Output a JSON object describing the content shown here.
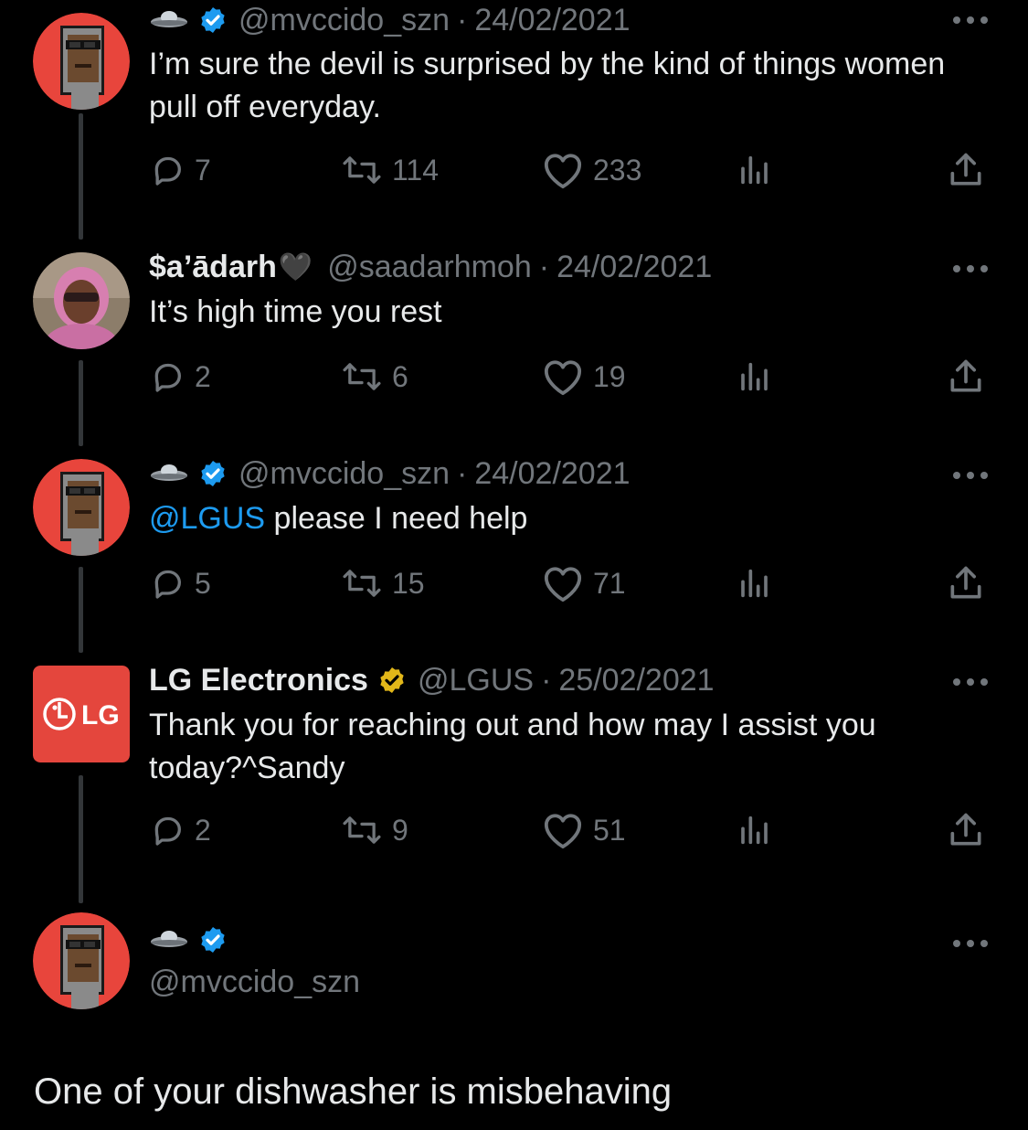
{
  "tweets": [
    {
      "name": "",
      "handle": "@mvccido_szn",
      "dot": "·",
      "date": "24/02/2021",
      "text": "I’m sure the devil is surprised by the kind of things women pull off everyday.",
      "replies": "7",
      "retweets": "114",
      "likes": "233",
      "avatar": "pixel-punk-avatar",
      "verified": "blue"
    },
    {
      "name": "$a’ādarh",
      "name_emoji": "🖤",
      "handle": "@saadarhmoh",
      "dot": "·",
      "date": "24/02/2021",
      "text": "It’s high time you rest",
      "replies": "2",
      "retweets": "6",
      "likes": "19",
      "avatar": "photo-avatar"
    },
    {
      "name": "",
      "handle": "@mvccido_szn",
      "dot": "·",
      "date": "24/02/2021",
      "mention": "@LGUS",
      "text": " please I need help",
      "replies": "5",
      "retweets": "15",
      "likes": "71",
      "avatar": "pixel-punk-avatar",
      "verified": "blue"
    },
    {
      "name": "LG Electronics",
      "handle": "@LGUS",
      "dot": "·",
      "date": "25/02/2021",
      "text": "Thank you for reaching out and how may I assist you today?^Sandy",
      "replies": "2",
      "retweets": "9",
      "likes": "51",
      "avatar": "lg-logo-avatar",
      "avatar_text": "LG",
      "verified": "gold"
    },
    {
      "name": "",
      "handle": "@mvccido_szn",
      "avatar": "pixel-punk-avatar",
      "verified": "blue"
    }
  ],
  "main_text": "One of your dishwasher is misbehaving",
  "colors": {
    "background": "#000000",
    "text": "#e7e9ea",
    "muted": "#71767b",
    "accent": "#1d9bf0",
    "gold": "#e2b719",
    "avatar_red": "#e8453c",
    "lg_red": "#e4463d"
  },
  "icons": [
    "ufo-emoji-icon",
    "verified-badge-icon",
    "reply-icon",
    "retweet-icon",
    "like-icon",
    "views-icon",
    "share-icon",
    "more-icon"
  ]
}
